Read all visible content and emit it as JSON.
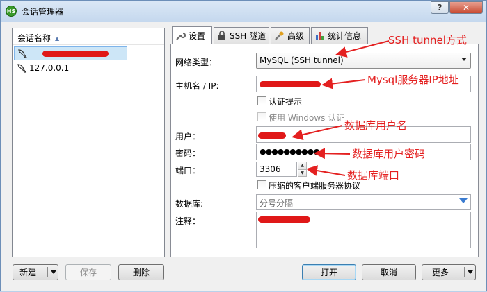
{
  "window": {
    "title": "会话管理器",
    "app_icon_text": "HS",
    "help_symbol": "?",
    "close_symbol": "✕"
  },
  "sessions": {
    "header": "会话名称",
    "items": [
      {
        "label": "",
        "selected": true
      },
      {
        "label": "127.0.0.1",
        "selected": false
      }
    ]
  },
  "tabs": [
    {
      "label": "设置",
      "icon": "wrench-icon",
      "active": true
    },
    {
      "label": "SSH 隧道",
      "icon": "lock-icon",
      "active": false
    },
    {
      "label": "高级",
      "icon": "tools-icon",
      "active": false
    },
    {
      "label": "统计信息",
      "icon": "bar-chart-icon",
      "active": false
    }
  ],
  "settings": {
    "network_type_label": "网络类型：",
    "network_type_value": "MySQL (SSH tunnel)",
    "host_label": "主机名 / IP:",
    "auth_prompt_label": "认证提示",
    "windows_auth_label": "使用 Windows 认证",
    "user_label": "用户：",
    "password_label": "密码：",
    "password_value": "●●●●●●●●●●",
    "port_label": "端口：",
    "port_value": "3306",
    "spin_up": "▲",
    "spin_down": "▼",
    "compress_label": "压缩的客户端服务器协议",
    "database_label": "数据库:",
    "database_placeholder": "分号分隔",
    "comment_label": "注释："
  },
  "buttons": {
    "new": "新建",
    "save": "保存",
    "delete": "删除",
    "open": "打开",
    "cancel": "取消",
    "more": "更多"
  },
  "annotations": {
    "ssh_tunnel": "SSH tunnel方式",
    "mysql_ip": "Mysql服务器IP地址",
    "db_user": "数据库用户名",
    "db_password": "数据库用户密码",
    "db_port": "数据库端口"
  },
  "colors": {
    "annotation": "#e42020",
    "selection": "#cde6f7",
    "titlebar": "#c5d8ee"
  }
}
